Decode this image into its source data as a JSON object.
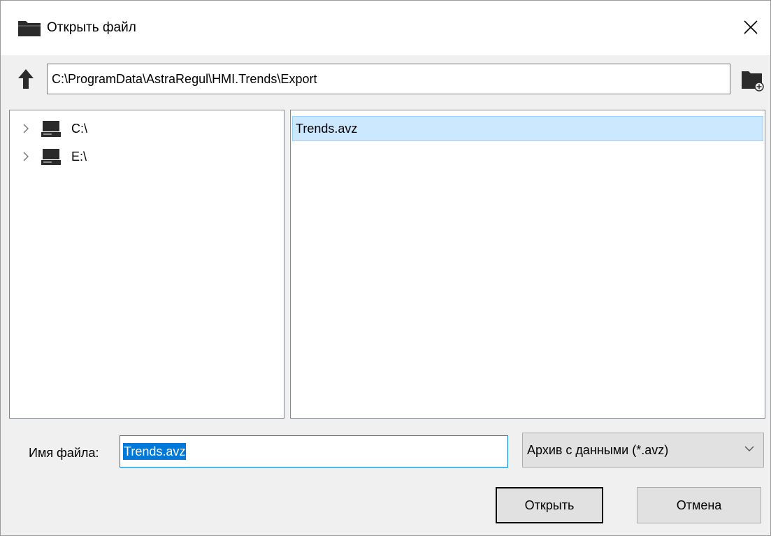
{
  "window": {
    "title": "Открыть файл",
    "icon": "folder-icon"
  },
  "toolbar": {
    "path": "C:\\ProgramData\\AstraRegul\\HMI.Trends\\Export"
  },
  "tree": {
    "items": [
      {
        "label": "C:\\",
        "icon": "drive-icon"
      },
      {
        "label": "E:\\",
        "icon": "drive-icon"
      }
    ]
  },
  "files": {
    "items": [
      {
        "name": "Trends.avz",
        "selected": true
      }
    ]
  },
  "footer": {
    "filename_label": "Имя файла:",
    "filename_value": "Trends.avz",
    "filter_value": "Архив с данными (*.avz)",
    "open_label": "Открыть",
    "cancel_label": "Отмена"
  },
  "colors": {
    "selection_bg": "#cce8ff",
    "selection_border": "#99d1ff",
    "focus_accent": "#0078d7"
  }
}
